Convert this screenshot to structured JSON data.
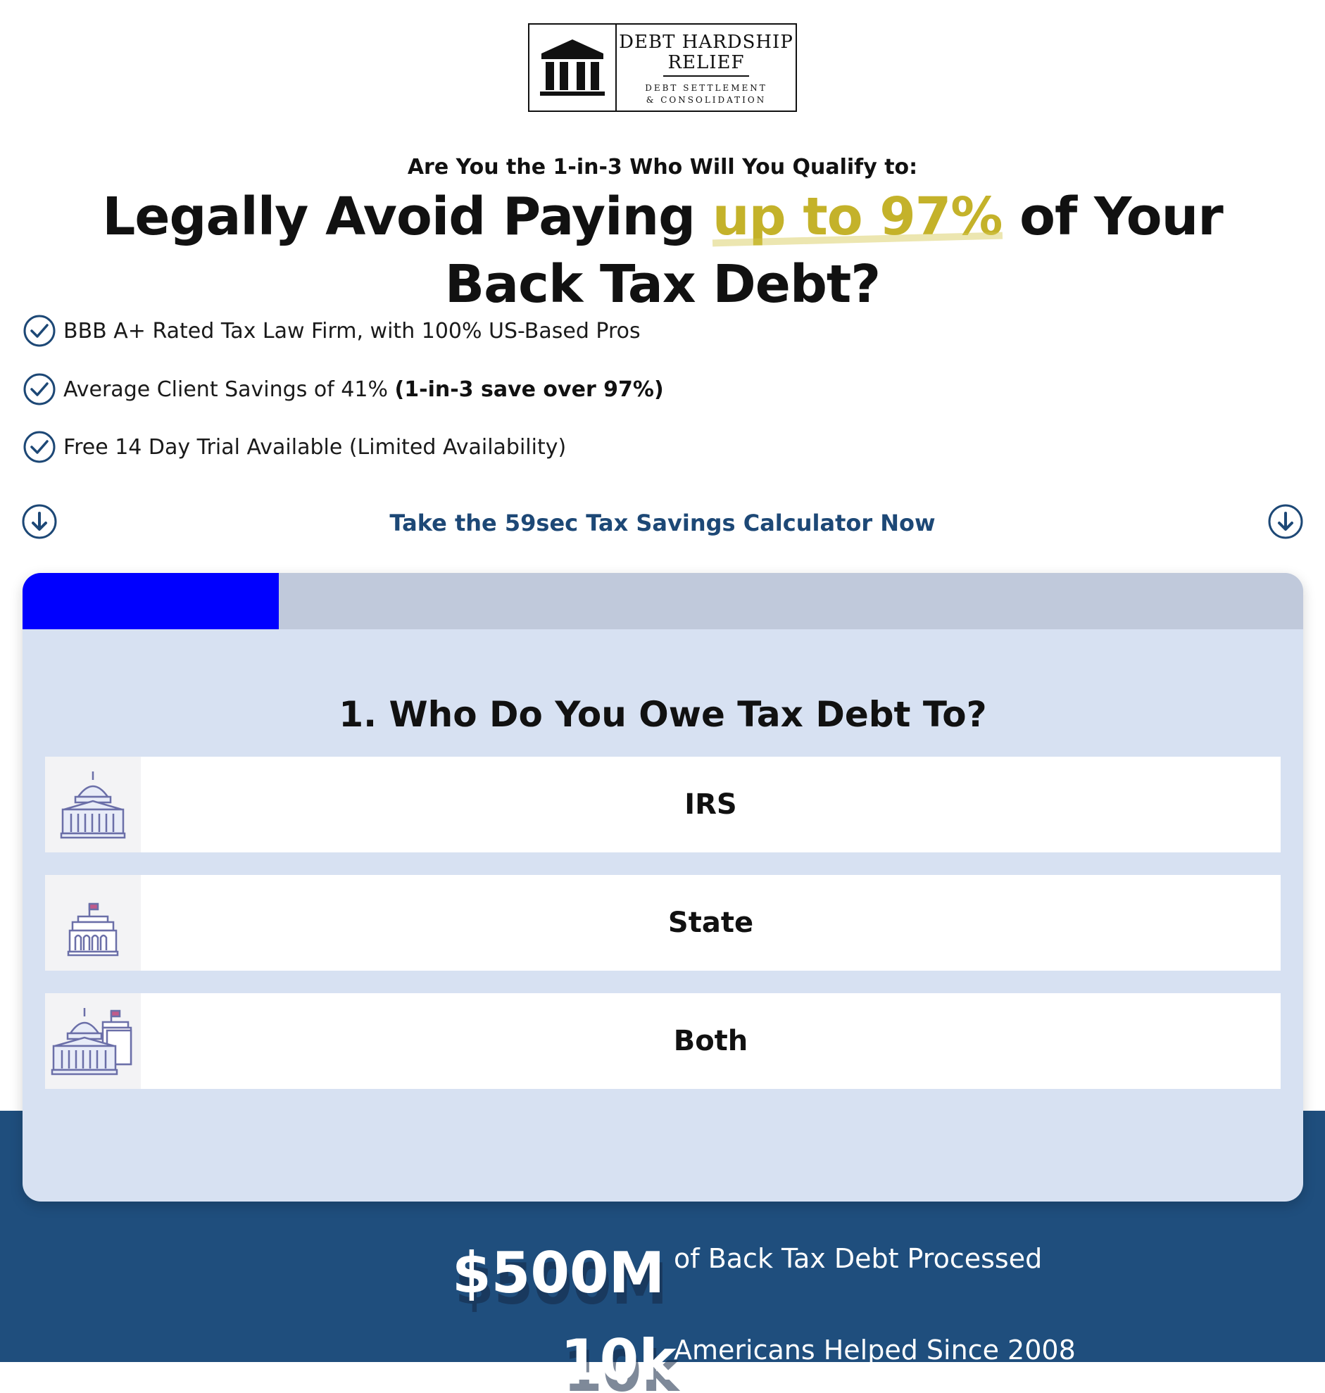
{
  "brand": {
    "line1": "DEBT HARDSHIP",
    "line2": "RELIEF",
    "line3": "DEBT SETTLEMENT",
    "line4": "& CONSOLIDATION",
    "logo_icon": "courthouse-columns-icon"
  },
  "hero": {
    "eyebrow": "Are You the 1-in-3 Who Will You Qualify to:",
    "headline_before": "Legally Avoid Paying ",
    "headline_highlight": "up to 97%",
    "headline_after": " of Your Back Tax Debt?",
    "highlight_color": "#c4b22a"
  },
  "benefits": [
    {
      "text": "BBB A+ Rated Tax Law Firm, with 100% US-Based Pros",
      "bold": ""
    },
    {
      "text": "Average Client Savings of 41% ",
      "bold": "(1-in-3 save over 97%)"
    },
    {
      "text": "Free 14 Day Trial Available (Limited Availability)",
      "bold": ""
    }
  ],
  "cta": {
    "text": "Take the 59sec Tax Savings Calculator Now",
    "icon": "arrow-down-circle-icon",
    "color": "#1d4876"
  },
  "quiz": {
    "progress": 0.2,
    "progress_color": "#0000ff",
    "question": "1. Who Do You Owe Tax Debt To?",
    "options": [
      {
        "label": "IRS",
        "icon": "capitol-building-icon"
      },
      {
        "label": "State",
        "icon": "state-building-icon"
      },
      {
        "label": "Both",
        "icon": "capitol-and-state-building-icon"
      }
    ]
  },
  "stats": [
    {
      "number": "$500M",
      "label": "of Back Tax Debt Processed"
    },
    {
      "number": "10k",
      "label": "Americans Helped Since 2008"
    }
  ],
  "colors": {
    "band": "#1f4e7d",
    "card": "#d7e1f2"
  }
}
